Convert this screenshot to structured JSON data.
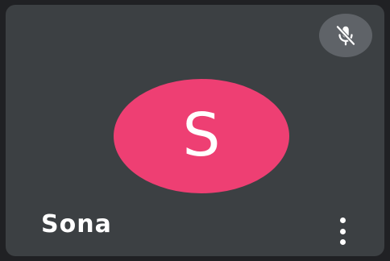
{
  "participant": {
    "name": "Sona",
    "avatar_initial": "S",
    "avatar_color": "#ee3f73",
    "mic_state": "muted"
  },
  "icons": {
    "mic": "mic-off-icon",
    "more": "more-vert-icon"
  },
  "colors": {
    "tile_background": "#3c4043",
    "badge_background": "#5f6368",
    "text": "#ffffff"
  }
}
